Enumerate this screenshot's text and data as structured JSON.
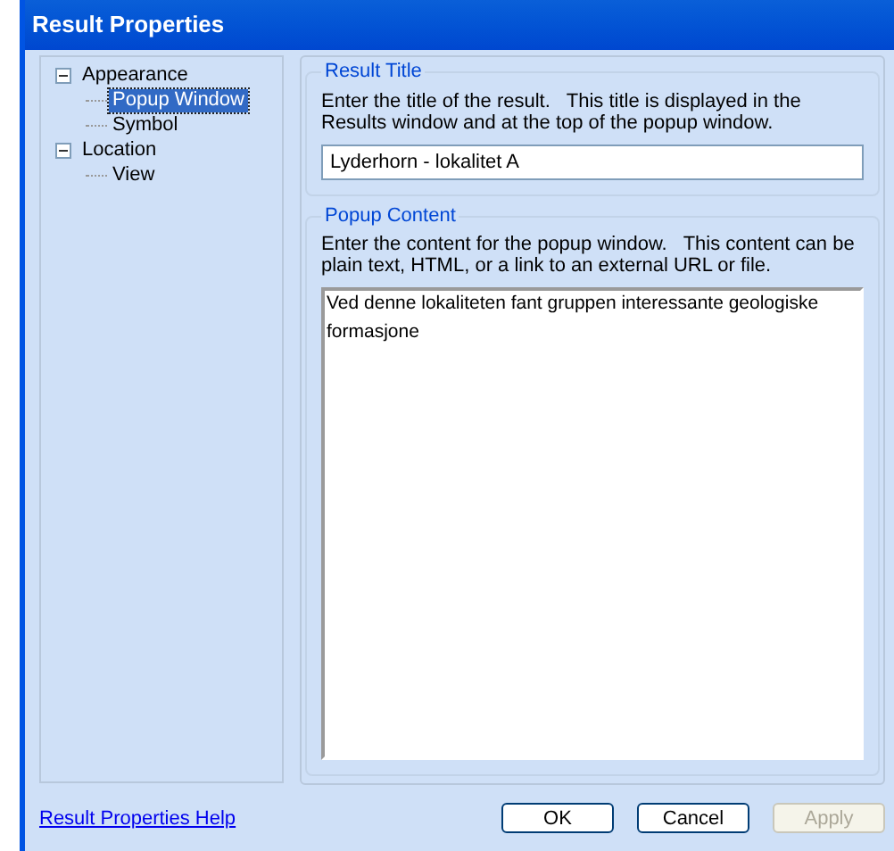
{
  "window": {
    "title": "Result Properties"
  },
  "tree": [
    {
      "label": "Appearance",
      "expanded": true,
      "selected": false,
      "children": [
        {
          "label": "Popup Window",
          "selected": true
        },
        {
          "label": "Symbol",
          "selected": false
        }
      ]
    },
    {
      "label": "Location",
      "expanded": true,
      "selected": false,
      "children": [
        {
          "label": "View",
          "selected": false
        }
      ]
    }
  ],
  "result_title": {
    "legend": "Result Title",
    "description": "Enter the title of the result.   This title is displayed in the Results window and at the top of the popup window.",
    "value": "Lyderhorn - lokalitet A"
  },
  "popup_content": {
    "legend": "Popup Content",
    "description": "Enter the content for the popup window.   This content can be plain text, HTML, or a link to an external URL or file.",
    "value": "Ved denne lokaliteten fant gruppen interessante geologiske formasjone"
  },
  "help_link": "Result Properties Help",
  "buttons": [
    {
      "label": "OK",
      "disabled": false
    },
    {
      "label": "Cancel",
      "disabled": false
    },
    {
      "label": "Apply",
      "disabled": true
    }
  ]
}
